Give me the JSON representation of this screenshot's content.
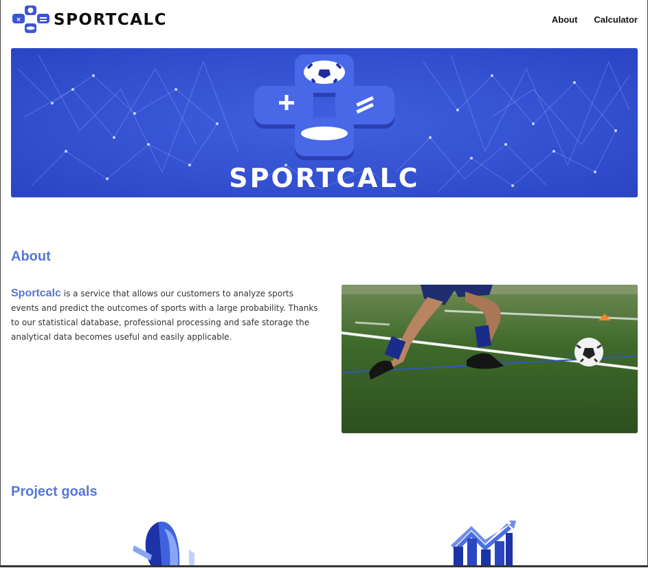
{
  "header": {
    "brand": "SPORTCALC",
    "nav": [
      {
        "label": "About"
      },
      {
        "label": "Calculator"
      }
    ]
  },
  "hero": {
    "title": "SPORTCALC"
  },
  "about": {
    "heading": "About",
    "brand_word": "Sportcalc",
    "body": " is a service that allows our customers to analyze sports events and predict the outcomes of sports with a large probability. Thanks to our statistical database, professional processing and safe storage the analytical data becomes useful and easily applicable."
  },
  "goals": {
    "heading": "Project goals"
  },
  "colors": {
    "accent": "#5577d4",
    "hero_blue": "#3252d6",
    "logo_blue": "#3b55d6"
  },
  "icons": [
    "logo-calculator-icon",
    "pie-chart-icon",
    "bar-chart-growth-icon"
  ]
}
